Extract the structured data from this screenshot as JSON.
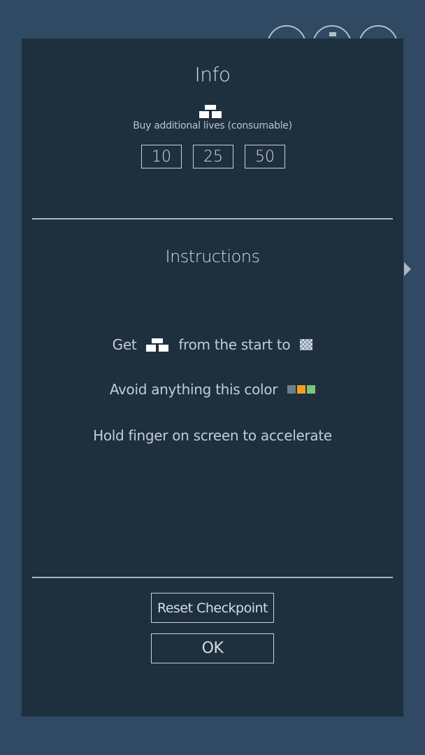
{
  "info": {
    "title": "Info",
    "icon": "player-block-icon",
    "subtitle": "Buy additional lives (consumable)",
    "lives_options": [
      "10",
      "25",
      "50"
    ]
  },
  "instructions": {
    "title": "Instructions",
    "line1_prefix": "Get",
    "line1_middle": "from the start to",
    "line2": "Avoid anything this color",
    "line3": "Hold finger on screen to accelerate",
    "hazard_colors": [
      "#6b7f8f",
      "#f0a020",
      "#7cc47c"
    ]
  },
  "actions": {
    "reset_label": "Reset Checkpoint",
    "ok_label": "OK"
  },
  "colors": {
    "background": "#2f4a62",
    "dialog": "#1e2f3e"
  }
}
